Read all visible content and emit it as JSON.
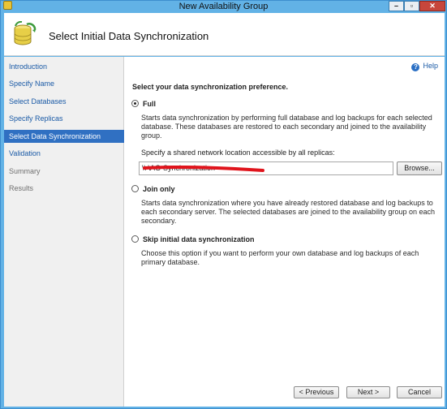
{
  "window": {
    "title": "New Availability Group"
  },
  "header": {
    "title": "Select Initial Data Synchronization",
    "icon": "database-sync-icon"
  },
  "nav": {
    "items": [
      {
        "label": "Introduction",
        "state": "link"
      },
      {
        "label": "Specify Name",
        "state": "link"
      },
      {
        "label": "Select Databases",
        "state": "link"
      },
      {
        "label": "Specify Replicas",
        "state": "link"
      },
      {
        "label": "Select Data Synchronization",
        "state": "selected"
      },
      {
        "label": "Validation",
        "state": "link"
      },
      {
        "label": "Summary",
        "state": "disabled"
      },
      {
        "label": "Results",
        "state": "disabled"
      }
    ]
  },
  "content": {
    "help_label": "Help",
    "prompt": "Select your data synchronization preference.",
    "options": [
      {
        "label": "Full",
        "checked": true,
        "description": "Starts data synchronization by performing full database and log backups for each selected database. These databases are restored to each secondary and joined to the availability group."
      },
      {
        "label": "Join only",
        "checked": false,
        "description": "Starts data synchronization where you have already restored database and log backups to each secondary server. The selected databases are joined to the availability group on each secondary."
      },
      {
        "label": "Skip initial data synchronization",
        "checked": false,
        "description": "Choose this option if you want to perform your own database and log backups of each primary database."
      }
    ],
    "share_label": "Specify a shared network location accessible by all replicas:",
    "share_value": "\\\\          \\AG-Synchronization",
    "browse_label": "Browse..."
  },
  "footer": {
    "previous_label": "< Previous",
    "next_label": "Next >",
    "cancel_label": "Cancel"
  },
  "colors": {
    "title_bar": "#62b2e6",
    "nav_selected": "#3070c2",
    "link": "#1a5aa6",
    "redaction": "#e0141c"
  }
}
